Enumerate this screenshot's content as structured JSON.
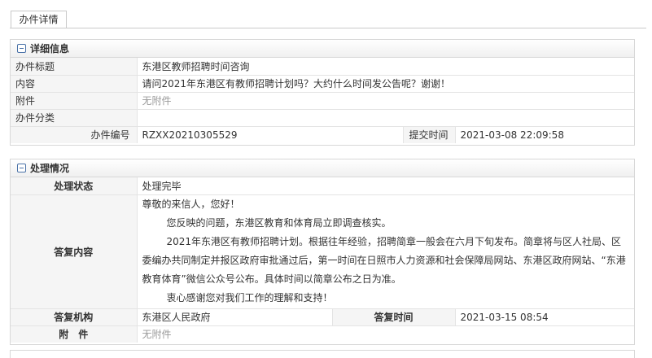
{
  "tab": {
    "label": "办件详情"
  },
  "detail": {
    "title": "详细信息",
    "rows": {
      "subject_label": "办件标题",
      "subject_value": "东港区教师招聘时间咨询",
      "content_label": "内容",
      "content_value": "请问2021年东港区有教师招聘计划吗？大约什么时间发公告呢？谢谢！",
      "attach_label": "附件",
      "attach_value": "无附件",
      "category_label": "办件分类",
      "category_value": "",
      "number_label": "办件编号",
      "number_value": "RZXX20210305529",
      "submit_label": "提交时间",
      "submit_value": "2021-03-08 22:09:58"
    }
  },
  "handling": {
    "title": "处理情况",
    "status_label": "处理状态",
    "status_value": "处理完毕",
    "reply_label": "答复内容",
    "reply": {
      "greeting": "尊敬的来信人，您好！",
      "p1": "您反映的问题，东港区教育和体育局立即调查核实。",
      "p2": "2021年东港区有教师招聘计划。根据往年经验，招聘简章一般会在六月下旬发布。简章将与区人社局、区委编办共同制定并报区政府审批通过后，第一时间在日照市人力资源和社会保障局网站、东港区政府网站、“东港教育体育”微信公众号公布。具体时间以简章公布之日为准。",
      "p3": "衷心感谢您对我们工作的理解和支持！"
    },
    "org_label": "答复机构",
    "org_value": "东港区人民政府",
    "time_label": "答复时间",
    "time_value": "2021-03-15 08:54",
    "attach_label": "附　件",
    "attach_value": "无附件"
  },
  "colors": {
    "border": "#d8d8d8",
    "label_bg": "#f5f5f5",
    "muted": "#999999",
    "icon": "#4a72a8"
  }
}
